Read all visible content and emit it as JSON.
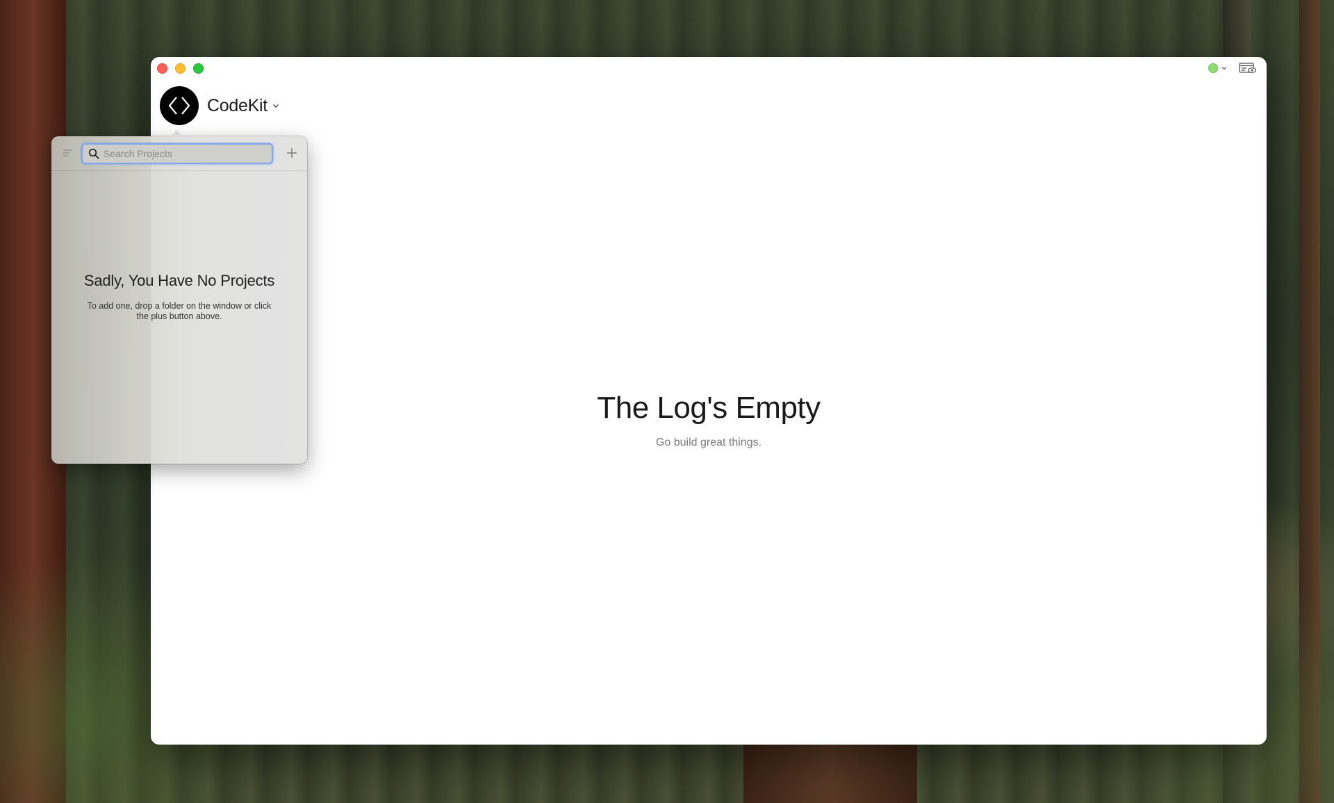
{
  "app": {
    "name": "CodeKit",
    "logo_icon": "code-brackets-icon"
  },
  "window_controls": [
    "close",
    "minimize",
    "zoom"
  ],
  "toolbar": {
    "status_icon": "server-status-icon",
    "status_color": "#8fdc72",
    "preview_icon": "browser-preview-icon"
  },
  "log": {
    "title": "The Log's Empty",
    "subtitle": "Go build great things."
  },
  "projects_popover": {
    "search_placeholder": "Search Projects",
    "search_value": "",
    "sort_icon": "sort-menu-icon",
    "add_icon": "plus-icon",
    "empty_title": "Sadly, You Have No Projects",
    "empty_body": "To add one, drop a folder on the window or click the plus button above."
  },
  "colors": {
    "accent_focus": "#7fa6e8",
    "close": "#fe5f57",
    "minimize": "#febc2e",
    "zoom": "#28c840"
  }
}
